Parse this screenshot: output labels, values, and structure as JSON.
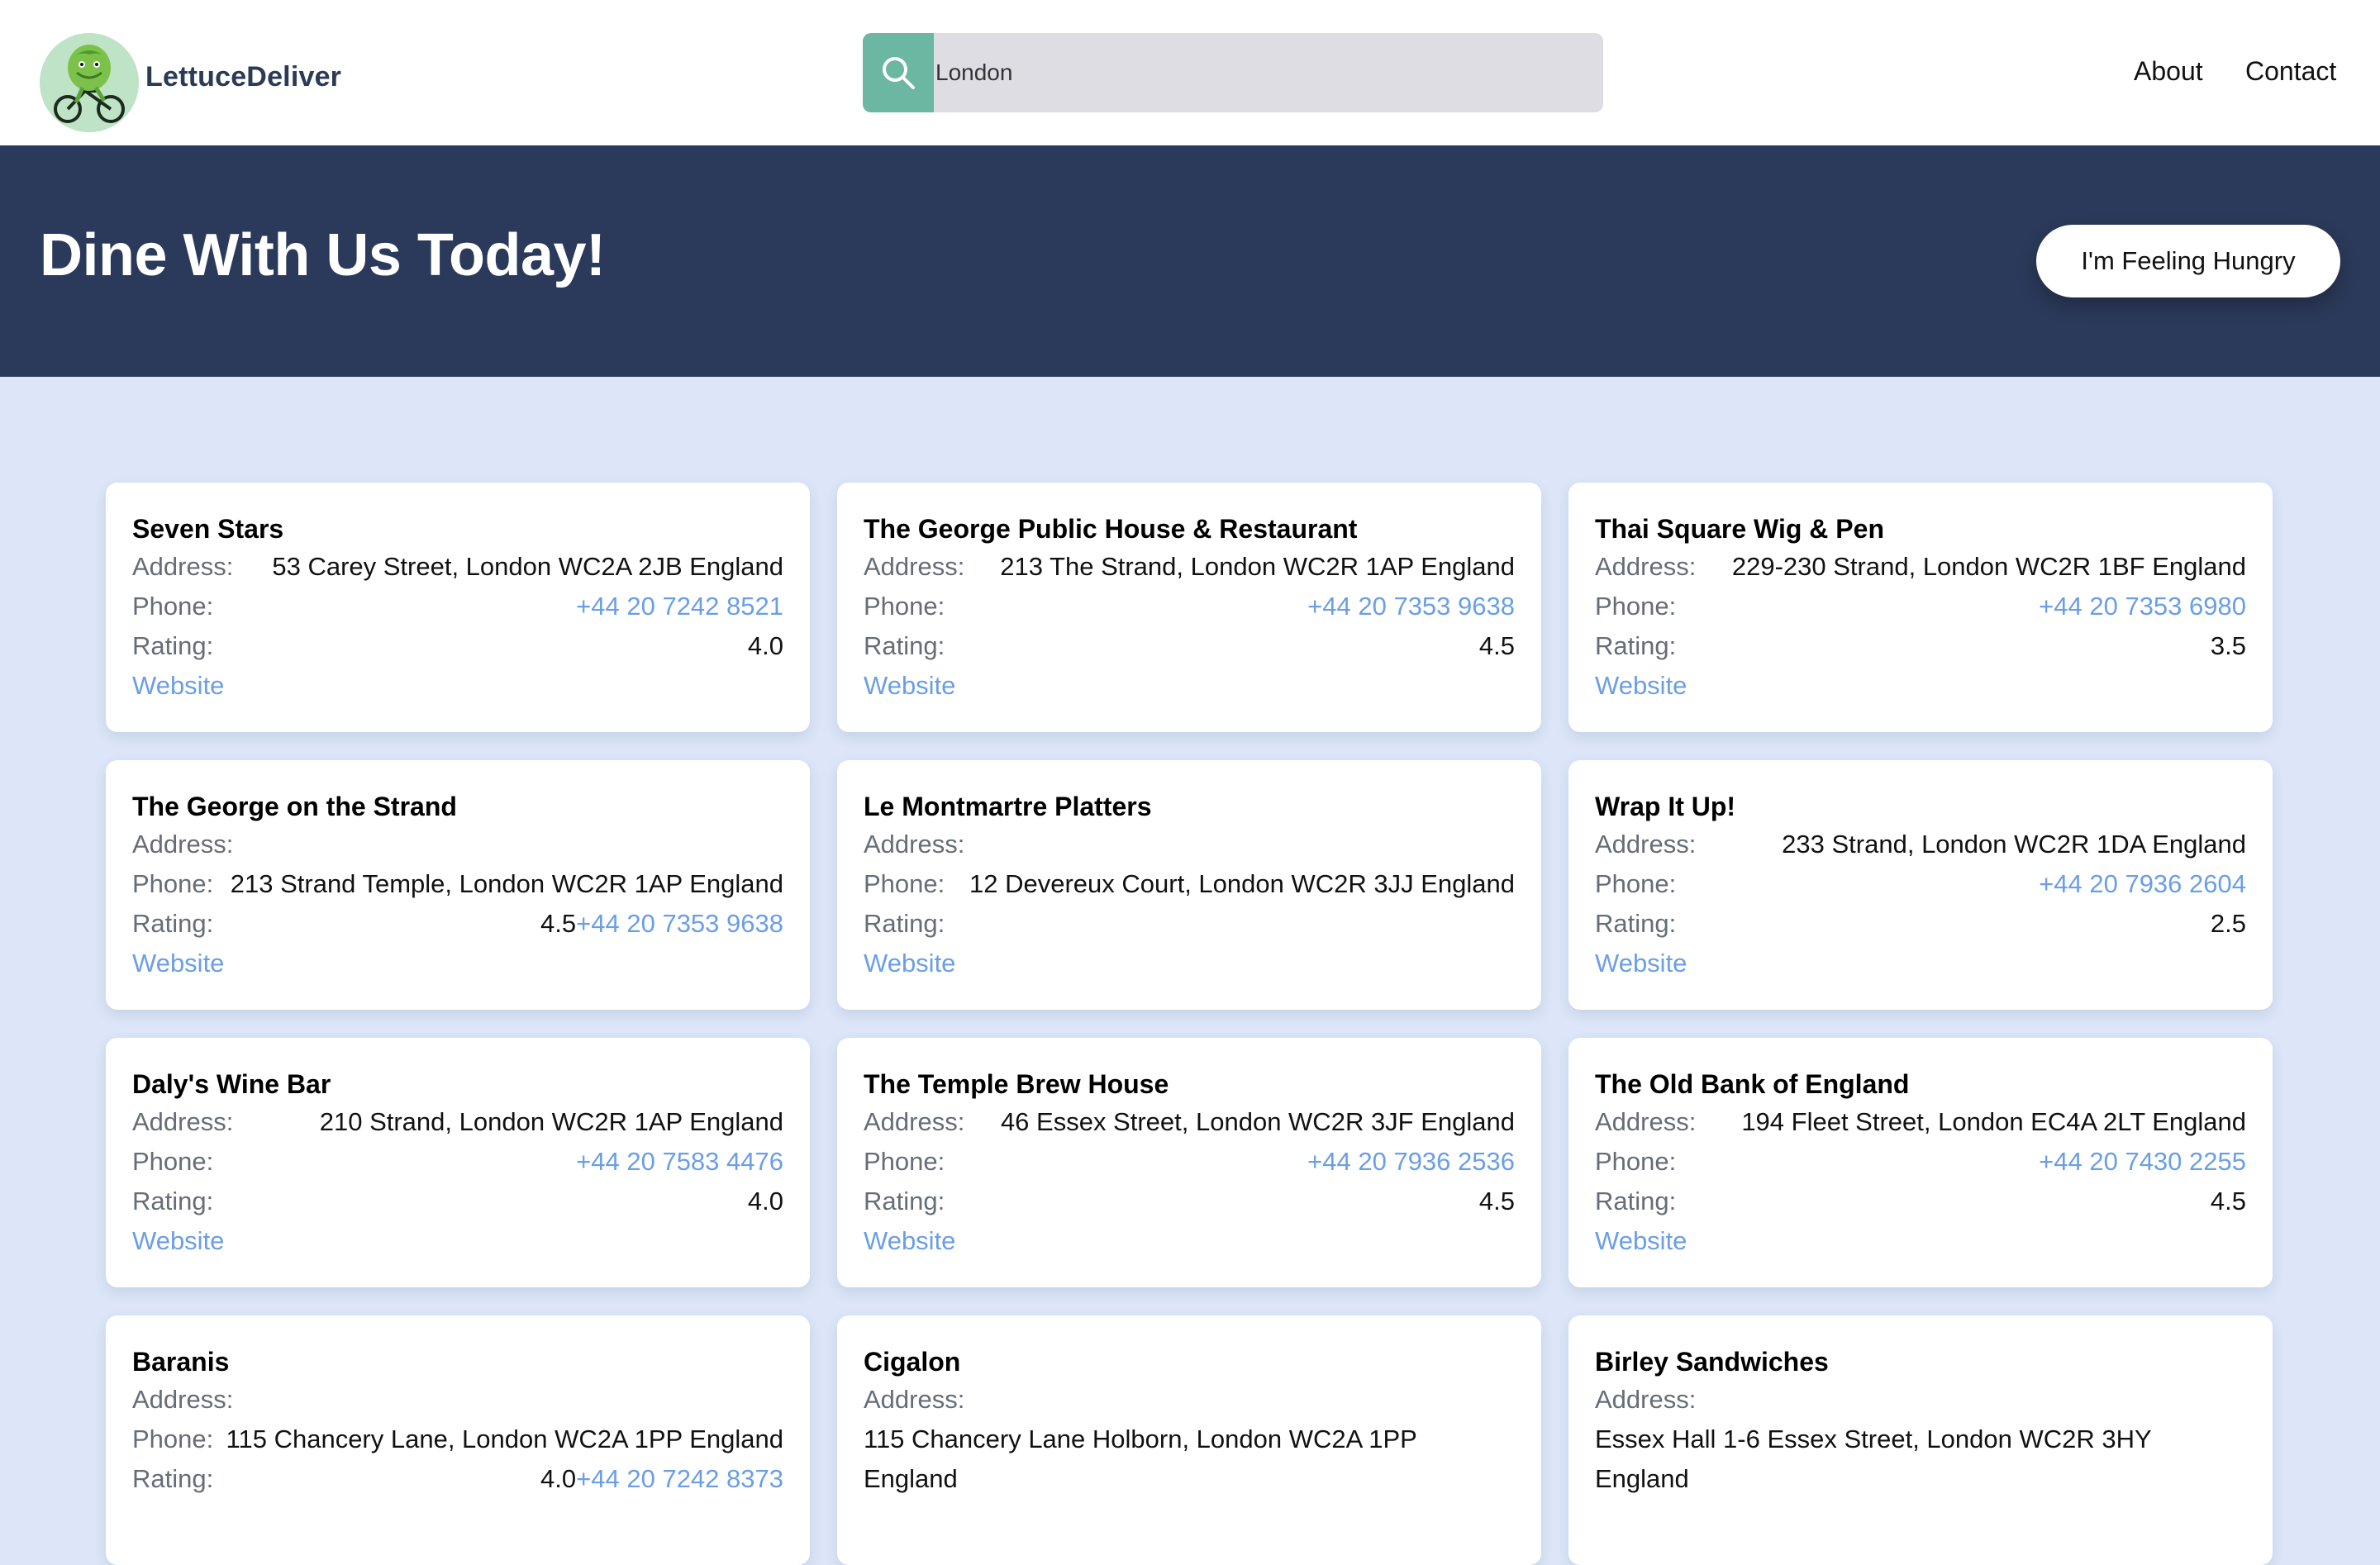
{
  "header": {
    "brand": "LettuceDeliver",
    "search": {
      "value": "London"
    },
    "nav": {
      "about": "About",
      "contact": "Contact"
    }
  },
  "hero": {
    "title": "Dine With Us Today!",
    "button": "I'm Feeling Hungry"
  },
  "labels": {
    "address": "Address:",
    "phone": "Phone:",
    "rating": "Rating:",
    "website": "Website"
  },
  "restaurants": [
    {
      "name": "Seven Stars",
      "address": "53 Carey Street, London WC2A 2JB England",
      "phone": "+44 20 7242 8521",
      "rating": "4.0"
    },
    {
      "name": "The George Public House & Restaurant",
      "address": "213 The Strand, London WC2R 1AP England",
      "phone": "+44 20 7353 9638",
      "rating": "4.5"
    },
    {
      "name": "Thai Square Wig & Pen",
      "address": "229-230 Strand, London WC2R 1BF England",
      "phone": "+44 20 7353 6980",
      "rating": "3.5"
    },
    {
      "name": "The George on the Strand",
      "address": "213 Strand Temple, London WC2R 1AP England",
      "phone": "+44 20 7353 9638",
      "rating": "4.5"
    },
    {
      "name": "Le Montmartre Platters",
      "address": "12 Devereux Court, London WC2R 3JJ England",
      "phone": "",
      "rating": ""
    },
    {
      "name": "Wrap It Up!",
      "address": "233 Strand, London WC2R 1DA England",
      "phone": "+44 20 7936 2604",
      "rating": "2.5"
    },
    {
      "name": "Daly's Wine Bar",
      "address": "210 Strand, London WC2R 1AP England",
      "phone": "+44 20 7583 4476",
      "rating": "4.0"
    },
    {
      "name": "The Temple Brew House",
      "address": "46 Essex Street, London WC2R 3JF England",
      "phone": "+44 20 7936 2536",
      "rating": "4.5"
    },
    {
      "name": "The Old Bank of England",
      "address": "194 Fleet Street, London EC4A 2LT England",
      "phone": "+44 20 7430 2255",
      "rating": "4.5"
    },
    {
      "name": "Baranis",
      "address": "115 Chancery Lane, London WC2A 1PP England",
      "phone": "+44 20 7242 8373",
      "rating": "4.0"
    },
    {
      "name": "Cigalon",
      "address_line1": "115 Chancery Lane Holborn, London WC2A 1PP",
      "address_line2": "England"
    },
    {
      "name": "Birley Sandwiches",
      "address_line1": "Essex Hall 1-6 Essex Street, London WC2R 3HY",
      "address_line2": "England"
    }
  ],
  "colors": {
    "header_bg": "#ffffff",
    "hero_bg": "#2b3a5a",
    "page_bg": "#dce6f8",
    "search_button": "#6cb7a1",
    "link": "#6b9ee6"
  },
  "icons": {
    "search": "search-icon",
    "logo": "lettuce-cyclist-logo"
  }
}
